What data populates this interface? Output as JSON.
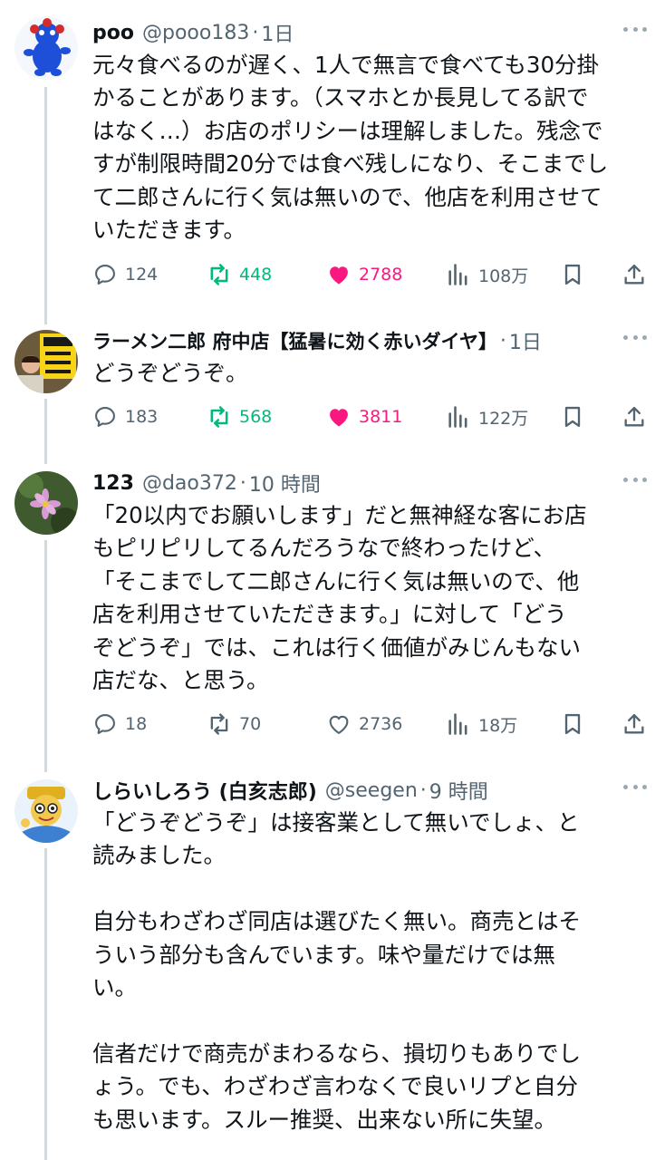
{
  "colors": {
    "text": "#0f1419",
    "muted": "#536471",
    "retweet_green": "#00ba7c",
    "like_pink": "#f91880",
    "thread_line": "#cfd9de"
  },
  "tweets": [
    {
      "name": "poo",
      "handle": "@pooo183",
      "dot": "·",
      "time": "1日",
      "text": "元々食べるのが遅く、1人で無言で食べても30分掛\nかることがあります。（スマホとか長見してる訳で\nはなく…）お店のポリシーは理解しました。残念で\nすが制限時間20分では食べ残しになり、そこまでし\nて二郎さんに行く気は無いので、他店を利用させて\nいただきます。",
      "replies": "124",
      "retweets": "448",
      "likes": "2788",
      "views": "108万",
      "liked": true,
      "retweeted": true,
      "avatar_icon": "blue-creature-avatar"
    },
    {
      "name": "ラーメン二郎 府中店【猛暑に効く赤いダイヤ】",
      "handle": "",
      "dot": "·",
      "time": "1日",
      "text": "どうぞどうぞ。",
      "replies": "183",
      "retweets": "568",
      "likes": "3811",
      "views": "122万",
      "liked": true,
      "retweeted": true,
      "avatar_icon": "ramen-shop-avatar"
    },
    {
      "name": "123",
      "handle": "@dao372",
      "dot": "·",
      "time": "10 時間",
      "text": "「20以内でお願いします」だと無神経な客にお店\nもピリピリしてるんだろうなで終わったけど、\n「そこまでして二郎さんに行く気は無いので、他\n店を利用させていただきます。」に対して「どう\nぞどうぞ」では、これは行く価値がみじんもない\n店だな、と思う。",
      "replies": "18",
      "retweets": "70",
      "likes": "2736",
      "views": "18万",
      "liked": false,
      "retweeted": false,
      "avatar_icon": "flower-photo-avatar"
    },
    {
      "name": "しらいしろう (白亥志郎)",
      "handle": "@seegen",
      "dot": "·",
      "time": "9 時間",
      "text": "「どうぞどうぞ」は接客業として無いでしょ、と\n読みました。\n\n自分もわざわざ同店は選びたく無い。商売とはそ\nういう部分も含んでいます。味や量だけでは無\nい。\n\n信者だけで商売がまわるなら、損切りもありでし\nょう。でも、わざわざ言わなくで良いリプと自分\nも思います。スルー推奨、出来ない所に失望。",
      "avatar_icon": "cartoon-character-avatar"
    }
  ]
}
